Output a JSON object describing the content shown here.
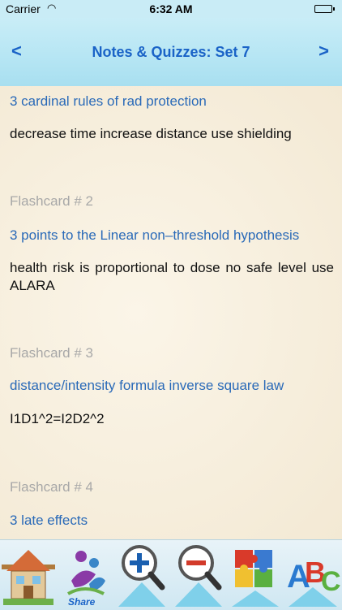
{
  "status": {
    "carrier": "Carrier",
    "time": "6:32 AM"
  },
  "nav": {
    "back": "<",
    "forward": ">",
    "title": "Notes & Quizzes:   Set 7"
  },
  "cards": [
    {
      "question": "3 cardinal rules of rad protection",
      "answer": "decrease time increase distance use shielding"
    },
    {
      "label": "Flashcard # 2",
      "question": "3 points to the Linear non–threshold hypothesis",
      "answer": "health risk is proportional to dose no safe level use ALARA"
    },
    {
      "label": "Flashcard # 3",
      "question": "distance/intensity formula inverse square law",
      "answer": "I1D1^2=I2D2^2"
    },
    {
      "label": "Flashcard # 4",
      "question": "3 late effects"
    }
  ],
  "tabs": {
    "home": "home-icon",
    "share": {
      "icon": "share-icon",
      "label": "Share"
    },
    "zoom_in": "zoom-in-icon",
    "zoom_out": "zoom-out-icon",
    "puzzle": "puzzle-icon",
    "abc": "abc-icon"
  },
  "colors": {
    "nav_bg": "#b7e6f4",
    "nav_text": "#1a63c7",
    "question": "#2a6ab8",
    "label": "#a8a8a8",
    "answer": "#111111"
  }
}
